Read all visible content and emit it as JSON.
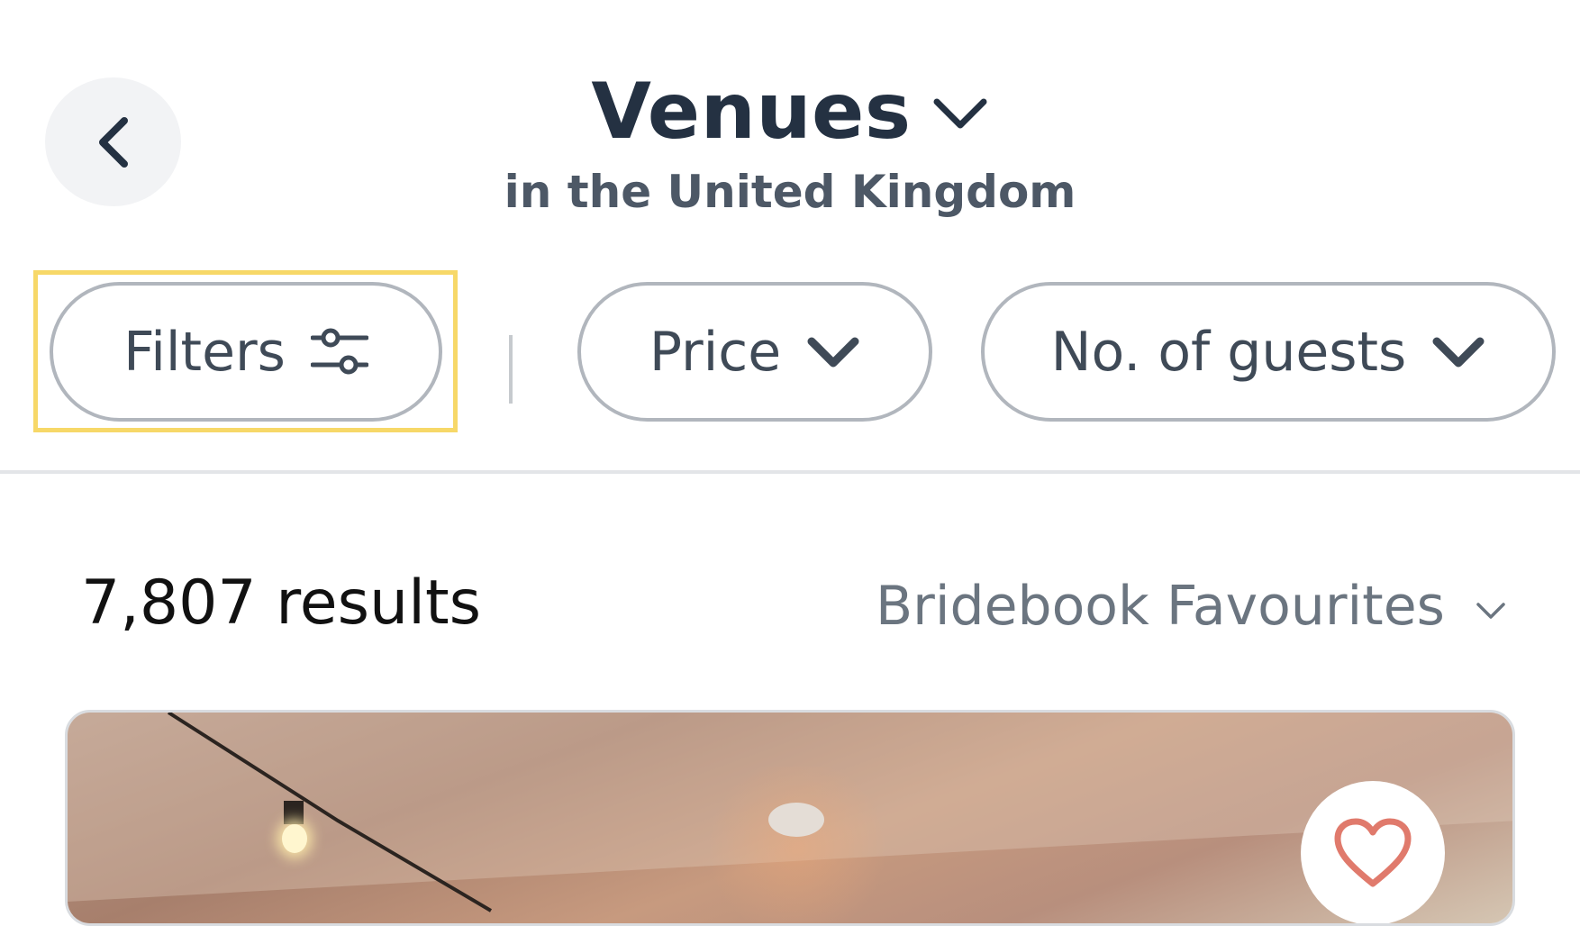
{
  "header": {
    "title": "Venues",
    "subtitle": "in the United Kingdom",
    "back_icon": "chevron-left-icon",
    "title_dropdown_icon": "chevron-down-icon"
  },
  "filters_bar": {
    "filters_label": "Filters",
    "filters_icon": "sliders-icon",
    "price_label": "Price",
    "guests_label": "No. of guests",
    "dropdown_icon": "chevron-down-icon",
    "focus_highlight_color": "#f7d868"
  },
  "results": {
    "count_text": "7,807 results",
    "sort_label": "Bridebook Favourites",
    "sort_icon": "chevron-down-icon"
  },
  "card": {
    "favourite_icon": "heart-icon",
    "favourite_color": "#e07a6c"
  },
  "colors": {
    "title": "#243142",
    "pill_border": "#b1b6bd",
    "text_muted": "#6b7580"
  }
}
